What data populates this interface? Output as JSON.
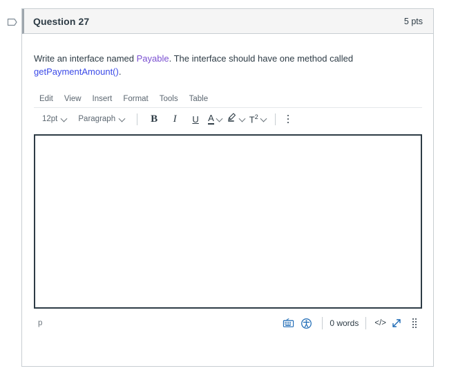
{
  "gutter": {
    "icon": "flag-outline-icon"
  },
  "question": {
    "title": "Question 27",
    "points": "5 pts",
    "prompt": {
      "before_link": "Write an interface named ",
      "link_visited": "Payable",
      "middle": ".  The interface should have one method called ",
      "link": "getPaymentAmount()",
      "after": "."
    }
  },
  "editor": {
    "menubar": [
      {
        "label": "Edit",
        "name": "menu-edit"
      },
      {
        "label": "View",
        "name": "menu-view"
      },
      {
        "label": "Insert",
        "name": "menu-insert"
      },
      {
        "label": "Format",
        "name": "menu-format"
      },
      {
        "label": "Tools",
        "name": "menu-tools"
      },
      {
        "label": "Table",
        "name": "menu-table"
      }
    ],
    "toolbar": {
      "font_size": "12pt",
      "block_format": "Paragraph",
      "bold": "B",
      "italic": "I",
      "underline": "U",
      "text_color_glyph": "A",
      "highlight_glyph": "✎",
      "superscript_glyph": "T",
      "superscript_exponent": "2",
      "more_options": "more-options-kebab"
    },
    "content": "",
    "status": {
      "element_path": "p",
      "word_count": "0 words",
      "html_editor_label": "</>",
      "keyboard_icon": "keyboard-shortcuts-icon",
      "accessibility_icon": "accessibility-checker-icon",
      "fullscreen_icon": "fullscreen-expand-icon",
      "resize_icon": "resize-grip-icon"
    }
  },
  "colors": {
    "header_bg": "#f5f5f5",
    "border": "#c7cdd1",
    "text": "#2d3b45",
    "link": "#3b4ae8",
    "link_visited": "#7a4fd1",
    "editor_border": "#2d3b45",
    "icon_blue": "#1d6ab5"
  }
}
